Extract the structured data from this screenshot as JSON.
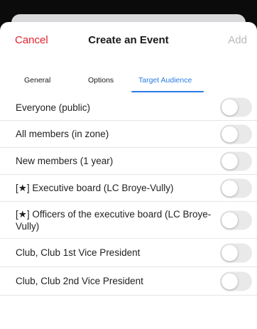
{
  "nav": {
    "cancel": "Cancel",
    "title": "Create an Event",
    "add": "Add"
  },
  "tabs": [
    {
      "label": "General",
      "active": false
    },
    {
      "label": "Options",
      "active": false
    },
    {
      "label": "Target Audience",
      "active": true
    }
  ],
  "audience": [
    {
      "label": "Everyone (public)",
      "enabled": false
    },
    {
      "label": "All members (in zone)",
      "enabled": false
    },
    {
      "label": "New members (1 year)",
      "enabled": false
    },
    {
      "label": "[★] Executive board (LC Broye-Vully)",
      "enabled": false
    },
    {
      "label": "[★] Officers of the executive board (LC Broye-Vully)",
      "enabled": false
    },
    {
      "label": "Club, Club 1st Vice President",
      "enabled": false
    },
    {
      "label": "Club, Club 2nd Vice President",
      "enabled": false
    }
  ],
  "colors": {
    "accent": "#2a7be4",
    "cancel": "#e0232b",
    "disabled": "#b9b9bd",
    "toggle_off": "#e9e9ea"
  }
}
